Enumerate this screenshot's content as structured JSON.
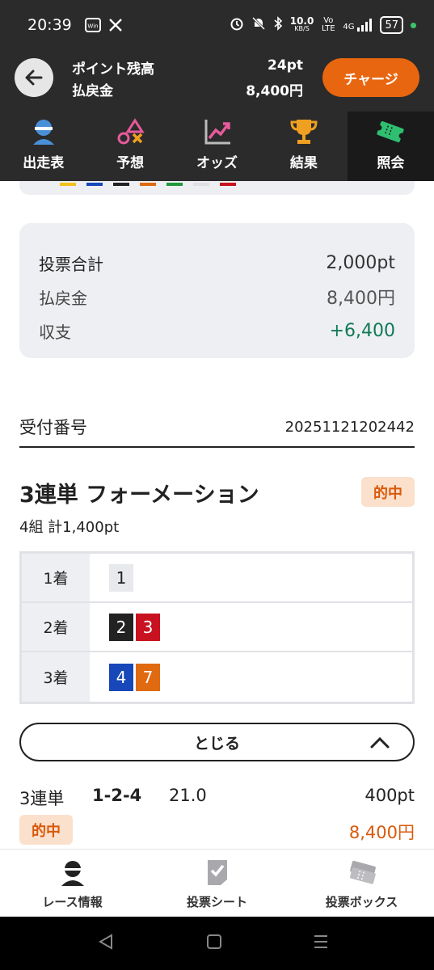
{
  "status_bar": {
    "time": "20:39",
    "speed_value": "10.0",
    "speed_unit": "KB/S",
    "volte": "Vo LTE",
    "network": "4G",
    "battery": "57"
  },
  "header": {
    "points_label": "ポイント残高",
    "points_value": "24pt",
    "refund_label": "払戻金",
    "refund_value": "8,400円",
    "charge_button": "チャージ"
  },
  "tabs": [
    {
      "label": "出走表",
      "icon": "jockey-icon"
    },
    {
      "label": "予想",
      "icon": "prediction-shapes-icon"
    },
    {
      "label": "オッズ",
      "icon": "chart-trend-icon"
    },
    {
      "label": "結果",
      "icon": "trophy-icon"
    },
    {
      "label": "照会",
      "icon": "ticket-icon",
      "active": true
    }
  ],
  "top_colors": [
    "#f2c21b",
    "#1747b8",
    "#222222",
    "#e06a10",
    "#1f9a3c",
    "#e8e9ec",
    "#c8121f"
  ],
  "summary": {
    "total_label": "投票合計",
    "total_value": "2,000pt",
    "refund_label": "払戻金",
    "refund_value": "8,400円",
    "balance_label": "収支",
    "balance_value": "+6,400"
  },
  "receipt": {
    "label": "受付番号",
    "value": "20251121202442"
  },
  "bet": {
    "title": "3連単 フォーメーション",
    "hit_badge": "的中",
    "subtitle": "4組 計1,400pt",
    "rows": [
      {
        "label": "1着",
        "numbers": [
          "1"
        ]
      },
      {
        "label": "2着",
        "numbers": [
          "2",
          "3"
        ]
      },
      {
        "label": "3着",
        "numbers": [
          "4",
          "7"
        ]
      }
    ],
    "close_button": "とじる"
  },
  "result": {
    "type": "3連単",
    "combo": "1-2-4",
    "odds": "21.0",
    "stake": "400pt",
    "hit_badge": "的中",
    "payout": "8,400円"
  },
  "bottom_nav": [
    {
      "label": "レース情報",
      "icon": "jockey-icon"
    },
    {
      "label": "投票シート",
      "icon": "check-sheet-icon"
    },
    {
      "label": "投票ボックス",
      "icon": "tickets-icon"
    }
  ],
  "colors": {
    "accent": "#e8660f",
    "header_bg": "#2b2b2b",
    "positive": "#0f7a55",
    "hit": "#d9590b"
  }
}
